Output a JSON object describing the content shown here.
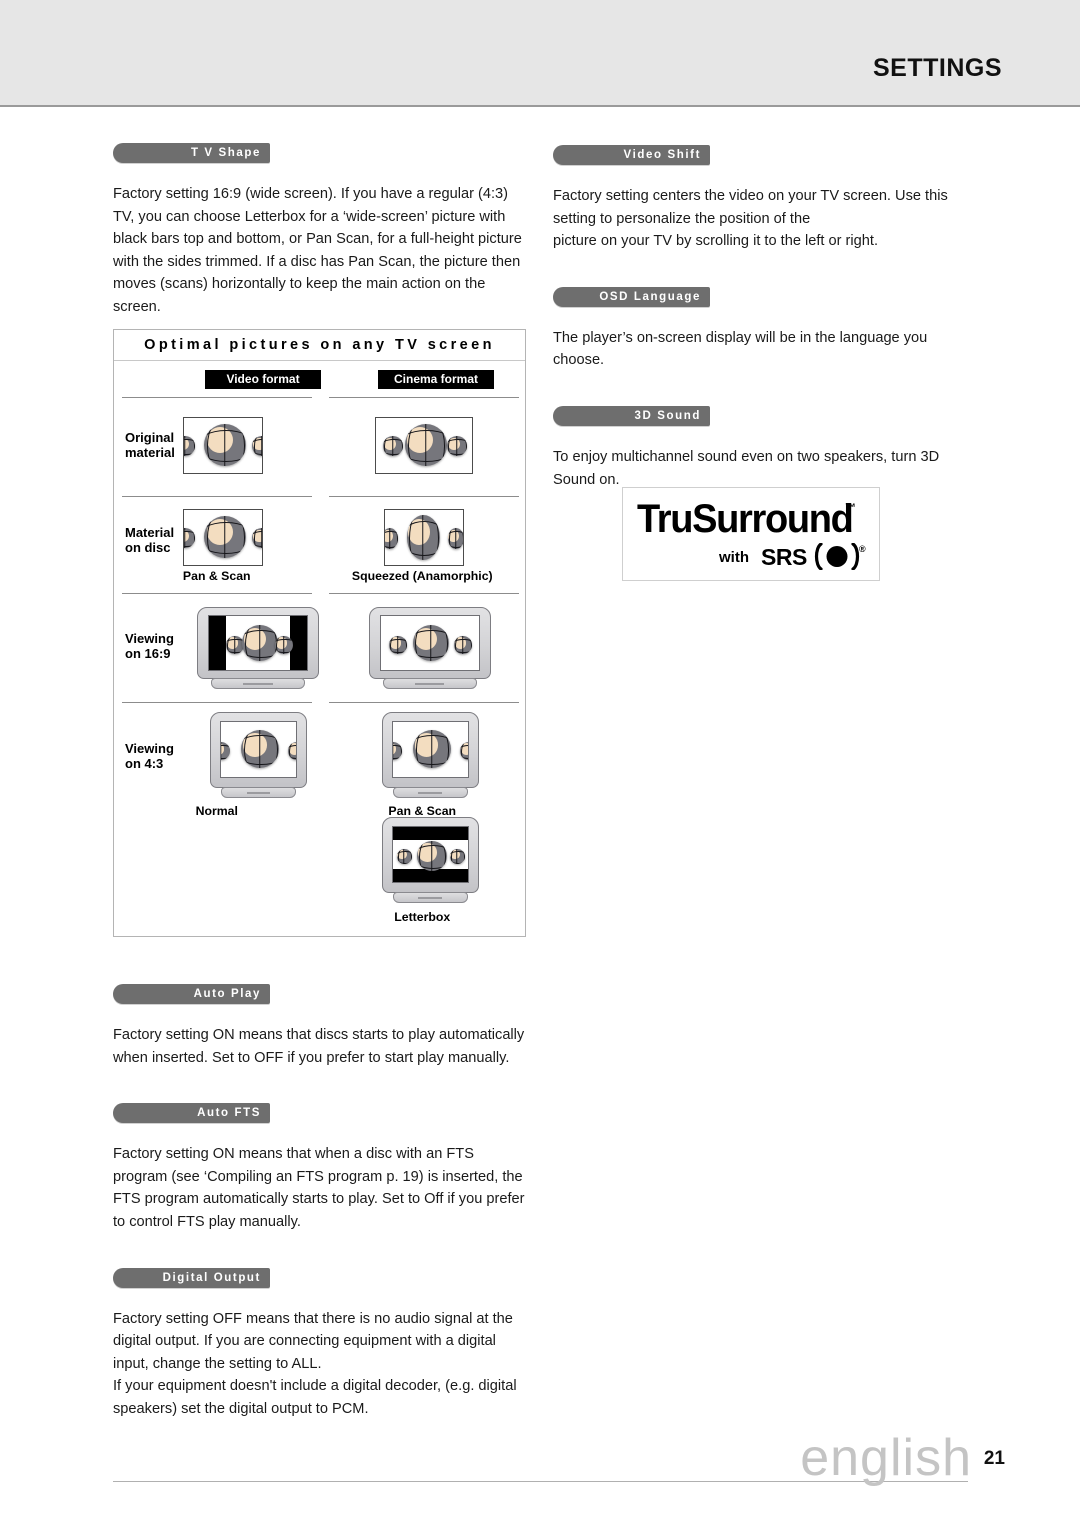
{
  "header": {
    "title": "SETTINGS"
  },
  "footer": {
    "language_word": "english",
    "page_number": "21"
  },
  "left_column": {
    "sections": [
      {
        "pill": "T V Shape",
        "text": "Factory setting 16:9 (wide screen). If you have a regular (4:3) TV, you can choose Letterbox for a ‘wide-screen’ picture with black bars top and bottom, or Pan Scan, for a full-height picture with the sides trimmed. If a disc has Pan Scan, the picture then moves (scans) horizontally to keep the main action on the screen."
      },
      {
        "pill": "Auto Play",
        "text": "Factory setting ON means that discs starts to play automatically when inserted. Set to OFF if you prefer to start play manually."
      },
      {
        "pill": "Auto FTS",
        "text": "Factory setting ON means that when a disc with an FTS program (see ‘Compiling an FTS program p. 19) is inserted, the FTS program automatically starts to play. Set to Off if you prefer to control FTS play manually."
      },
      {
        "pill": "Digital Output",
        "text": "Factory setting OFF means that there is no audio signal at the digital output. If you are connecting equipment with a digital input, change the setting to ALL.",
        "text2": "If your equipment doesn't include a digital decoder, (e.g. digital speakers) set the digital output to PCM."
      }
    ]
  },
  "right_column": {
    "sections": [
      {
        "pill": "Video Shift",
        "text": "Factory setting centers the video on your TV screen. Use this setting to personalize the position of the",
        "text2": "picture on your TV by scrolling it to the left or right."
      },
      {
        "pill": "OSD Language",
        "text": "The player’s on-screen display will be in the language you choose."
      },
      {
        "pill": "3D Sound",
        "text": "To enjoy multichannel sound even on two speakers, turn 3D Sound on."
      }
    ]
  },
  "logo": {
    "brand": "TruSurround",
    "trademark": "™",
    "with": "with",
    "srs": "SRS",
    "registered": "®"
  },
  "diagram": {
    "title": "Optimal pictures on any TV screen",
    "column_headers": [
      "Video format",
      "Cinema format"
    ],
    "rows": [
      {
        "label_line1": "Original",
        "label_line2": "material",
        "captions": [
          "",
          ""
        ]
      },
      {
        "label_line1": "Material",
        "label_line2": "on disc",
        "captions": [
          "Pan & Scan",
          "Squeezed (Anamorphic)"
        ]
      },
      {
        "label_line1": "Viewing",
        "label_line2": "on 16:9",
        "captions": [
          "",
          ""
        ]
      },
      {
        "label_line1": "Viewing",
        "label_line2": "on 4:3",
        "captions": [
          "Normal",
          "Pan & Scan"
        ]
      },
      {
        "label_line1": "",
        "label_line2": "",
        "captions": [
          "",
          "Letterbox"
        ]
      }
    ]
  }
}
